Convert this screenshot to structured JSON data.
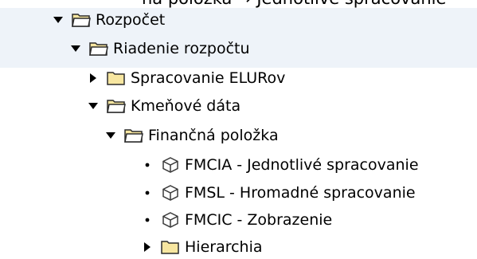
{
  "clipped_text": "ná položka → Jednotlivé spracovanie",
  "tree": {
    "nodes": [
      {
        "label": "Rozpočet",
        "type": "folder-open",
        "toggle": "expanded"
      },
      {
        "label": "Riadenie rozpočtu",
        "type": "folder-open",
        "toggle": "expanded"
      },
      {
        "label": "Spracovanie ELURov",
        "type": "folder",
        "toggle": "collapsed"
      },
      {
        "label": "Kmeňové dáta",
        "type": "folder-open",
        "toggle": "expanded"
      },
      {
        "label": "Finančná položka",
        "type": "folder-open",
        "toggle": "expanded"
      },
      {
        "label": "FMCIA - Jednotlivé spracovanie",
        "type": "transaction",
        "toggle": "leaf"
      },
      {
        "label": "FMSL - Hromadné spracovanie",
        "type": "transaction",
        "toggle": "leaf"
      },
      {
        "label": "FMCIC - Zobrazenie",
        "type": "transaction",
        "toggle": "leaf"
      },
      {
        "label": "Hierarchia",
        "type": "folder",
        "toggle": "collapsed"
      }
    ]
  },
  "colors": {
    "folder_fill": "#f7e6a0",
    "folder_stroke": "#2b2b2b",
    "transaction_stroke": "#3a3a3a",
    "selection_band": "#eef3f9"
  }
}
